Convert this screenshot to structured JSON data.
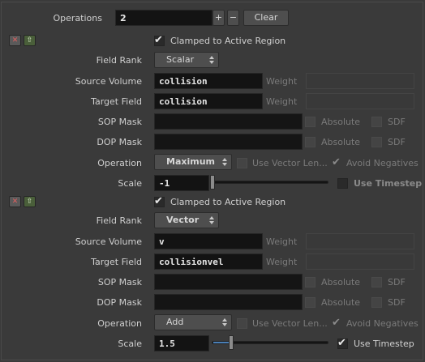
{
  "header": {
    "operations_label": "Operations",
    "operations_value": "2",
    "plus": "+",
    "minus": "−",
    "clear_label": "Clear"
  },
  "blocks": [
    {
      "clamped_label": "Clamped to Active Region",
      "clamped_checked": true,
      "field_rank_label": "Field Rank",
      "field_rank_value": "Scalar",
      "source_volume_label": "Source Volume",
      "source_volume_value": "collision",
      "target_field_label": "Target Field",
      "target_field_value": "collision",
      "weight_label": "Weight",
      "sop_mask_label": "SOP Mask",
      "dop_mask_label": "DOP Mask",
      "absolute_label": "Absolute",
      "sdf_label": "SDF",
      "operation_label": "Operation",
      "operation_value": "Maximum",
      "use_vector_label": "Use Vector Len...",
      "avoid_neg_label": "Avoid Negatives",
      "scale_label": "Scale",
      "scale_value": "-1",
      "use_timestep_label": "Use Timestep",
      "use_timestep_checked": false
    },
    {
      "clamped_label": "Clamped to Active Region",
      "clamped_checked": true,
      "field_rank_label": "Field Rank",
      "field_rank_value": "Vector",
      "source_volume_label": "Source Volume",
      "source_volume_value": "v",
      "target_field_label": "Target Field",
      "target_field_value": "collisionvel",
      "weight_label": "Weight",
      "sop_mask_label": "SOP Mask",
      "dop_mask_label": "DOP Mask",
      "absolute_label": "Absolute",
      "sdf_label": "SDF",
      "operation_label": "Operation",
      "operation_value": "Add",
      "use_vector_label": "Use Vector Len...",
      "avoid_neg_label": "Avoid Negatives",
      "scale_label": "Scale",
      "scale_value": "1.5",
      "use_timestep_label": "Use Timestep",
      "use_timestep_checked": true
    }
  ],
  "colors": {
    "background": "#3a3a3a",
    "field_bg": "#131313",
    "accent": "#4a7fb6"
  }
}
